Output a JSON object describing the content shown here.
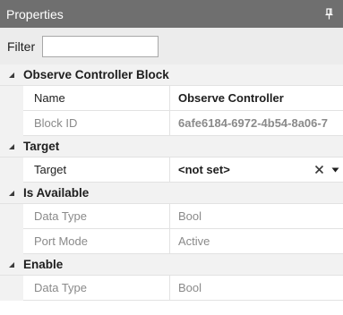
{
  "panel": {
    "title": "Properties",
    "pin_icon": "pin-icon"
  },
  "filter": {
    "label": "Filter",
    "value": ""
  },
  "categories": [
    {
      "label": "Observe Controller Block",
      "properties": [
        {
          "name": "Name",
          "value": "Observe Controller"
        },
        {
          "name": "Block ID",
          "value": "6afe6184-6972-4b54-8a06-7"
        }
      ]
    },
    {
      "label": "Target",
      "properties": [
        {
          "name": "Target",
          "value": "<not set>"
        }
      ]
    },
    {
      "label": "Is Available",
      "properties": [
        {
          "name": "Data Type",
          "value": "Bool"
        },
        {
          "name": "Port Mode",
          "value": "Active"
        }
      ]
    },
    {
      "label": "Enable",
      "properties": [
        {
          "name": "Data Type",
          "value": "Bool"
        }
      ]
    }
  ],
  "icons": {
    "collapse": "triangle-collapse-icon",
    "clear": "close-icon",
    "dropdown": "caret-down-icon"
  },
  "colors": {
    "titlebar_bg": "#6f6f6f",
    "filter_bg": "#ececec",
    "category_bg": "#f2f2f2",
    "grid_line": "#e2e2e2",
    "muted_text": "#8a8a8a"
  }
}
